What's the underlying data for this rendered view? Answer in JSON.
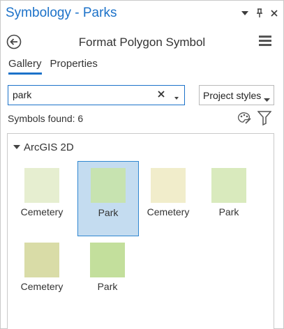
{
  "pane": {
    "title": "Symbology - Parks"
  },
  "header": {
    "title": "Format Polygon Symbol"
  },
  "tabs": [
    {
      "label": "Gallery",
      "active": true
    },
    {
      "label": "Properties",
      "active": false
    }
  ],
  "search": {
    "value": "park",
    "placeholder": ""
  },
  "styles_dropdown": {
    "selected": "Project styles"
  },
  "results": {
    "found_text": "Symbols found: 6"
  },
  "gallery": {
    "group_label": "ArcGIS 2D",
    "symbols": [
      {
        "label": "Cemetery",
        "color": "#e6eed0",
        "selected": false
      },
      {
        "label": "Park",
        "color": "#c7e3b0",
        "selected": true
      },
      {
        "label": "Cemetery",
        "color": "#f1edcb",
        "selected": false
      },
      {
        "label": "Park",
        "color": "#d9eabd",
        "selected": false
      },
      {
        "label": "Cemetery",
        "color": "#d9dca7",
        "selected": false
      },
      {
        "label": "Park",
        "color": "#c3df9c",
        "selected": false
      }
    ]
  },
  "colors": {
    "accent": "#1c72c9",
    "selection_bg": "#c4dcf0"
  }
}
